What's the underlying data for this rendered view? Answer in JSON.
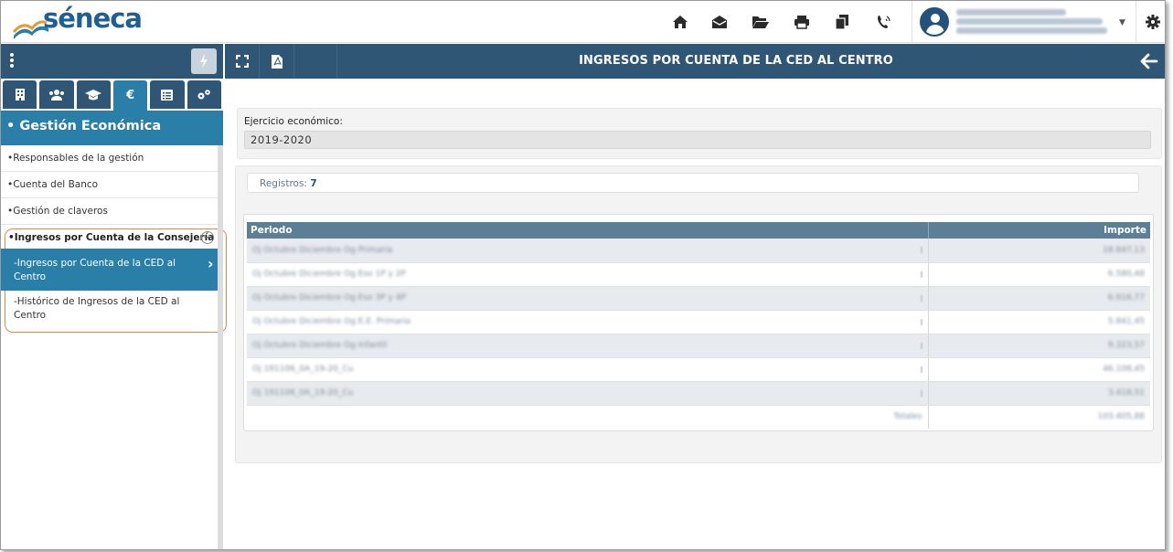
{
  "header": {
    "logo_text": "séneca",
    "icons": [
      "home-icon",
      "mail-icon",
      "folder-open-icon",
      "print-icon",
      "copy-icon",
      "phone-icon",
      "gear-icon"
    ],
    "user": {
      "lines": [
        "████████████████",
        "████████████████████",
        "████████████████████████"
      ]
    }
  },
  "sidebar": {
    "tabs": [
      "building-icon",
      "users-icon",
      "graduation-icon",
      "€",
      "list-icon",
      "cogs-icon"
    ],
    "title": "• Gestión Económica",
    "items": [
      "•Responsables de la gestión",
      "•Cuenta del Banco",
      "•Gestión de claveros"
    ],
    "group_label": "•Ingresos por Cuenta de la Consejería",
    "group_toggle": "−",
    "active_item": "-Ingresos por Cuenta de la CED al Centro",
    "sub_item": "-Histórico de Ingresos de la CED al Centro"
  },
  "toolbar": {
    "title": "INGRESOS POR CUENTA DE LA CED AL CENTRO"
  },
  "filter": {
    "label": "Ejercicio económico:",
    "value": "2019-2020"
  },
  "records": {
    "label": "Registros:",
    "count": "7"
  },
  "table": {
    "headers": {
      "periodo": "Periodo",
      "importe": "Importe"
    },
    "rows": [
      {
        "periodo": "Oj Octubre Diciembre Og Primaria",
        "importe": "18.847,13"
      },
      {
        "periodo": "Oj Octubre Diciembre Og Eso 1P y 2P",
        "importe": "6.580,48"
      },
      {
        "periodo": "Oj Octubre Diciembre Og Eso 3P y 4P",
        "importe": "6.916,77"
      },
      {
        "periodo": "Oj Octubre Diciembre Og E.E. Primaria",
        "importe": "5.841,45"
      },
      {
        "periodo": "Oj Octubre Diciembre Og Infantil",
        "importe": "9.323,57"
      },
      {
        "periodo": "Oj 191106_0A_19-20_Cu",
        "importe": "46.108,45"
      },
      {
        "periodo": "Oj 191106_0A_19-20_Cu",
        "importe": "3.418,51"
      }
    ],
    "totals_label": "Totales",
    "totals_value": "103.405,88"
  }
}
